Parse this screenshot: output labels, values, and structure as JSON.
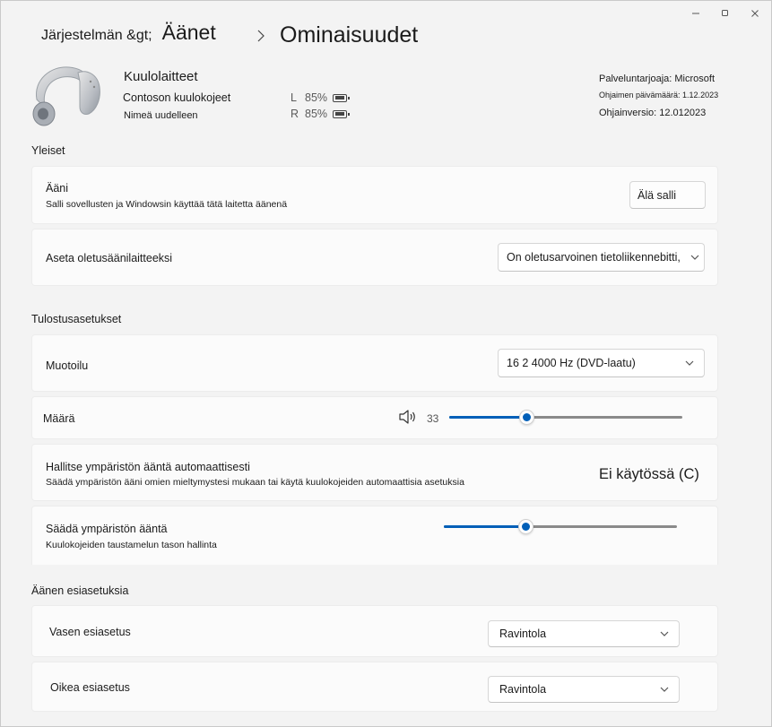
{
  "breadcrumb": {
    "root": "Järjestelmän &gt;",
    "middle": "Äänet",
    "current": "Ominaisuudet"
  },
  "device": {
    "title": "Kuulolaitteet",
    "name": "Contoson kuulokojeet",
    "rename": "Nimeä uudelleen",
    "battery_left_side": "L",
    "battery_left": "85%",
    "battery_right_side": "R",
    "battery_right": "85%",
    "provider": "Palveluntarjoaja: Microsoft",
    "driver_date": "Ohjaimen päivämäärä: 1.12.2023",
    "driver_version": "Ohjainversio: 12.012023"
  },
  "general": {
    "title": "Yleiset",
    "audio_label": "Ääni",
    "audio_sub": "Salli sovellusten ja Windowsin käyttää tätä laitetta äänenä",
    "audio_button": "Älä salli",
    "default_label": "Aseta oletusäänilaitteeksi",
    "default_value": "On oletusarvoinen tietoliikennebitti,"
  },
  "output": {
    "title": "Tulostusasetukset",
    "format_label": "Muotoilu",
    "format_value": "16 2 4000 Hz (DVD-laatu)",
    "volume_label": "Määrä",
    "volume_value": "33",
    "volume_level": 0.33,
    "ambient_auto_label": "Hallitse ympäristön ääntä automaattisesti",
    "ambient_auto_sub": "Säädä ympäristön ääni omien mieltymystesi mukaan tai käytä kuulokojeiden automaattisia asetuksia",
    "ambient_auto_state": "Ei käytössä (C)",
    "ambient_label": "Säädä ympäristön ääntä",
    "ambient_sub": "Kuulokojeiden taustamelun tason hallinta",
    "ambient_level": 0.35
  },
  "presets": {
    "title": "Äänen esiasetuksia",
    "left_label": "Vasen esiasetus",
    "left_value": "Ravintola",
    "right_label": "Oikea esiasetus",
    "right_value": "Ravintola"
  },
  "colors": {
    "accent": "#005fb8",
    "track": "#8a8a8a",
    "background": "#f3f3f3",
    "card": "#fbfbfb"
  },
  "icons": [
    "minimize-icon",
    "maximize-icon",
    "close-icon",
    "chevron-right-icon",
    "battery-icon",
    "chevron-down-icon",
    "speaker-icon"
  ]
}
